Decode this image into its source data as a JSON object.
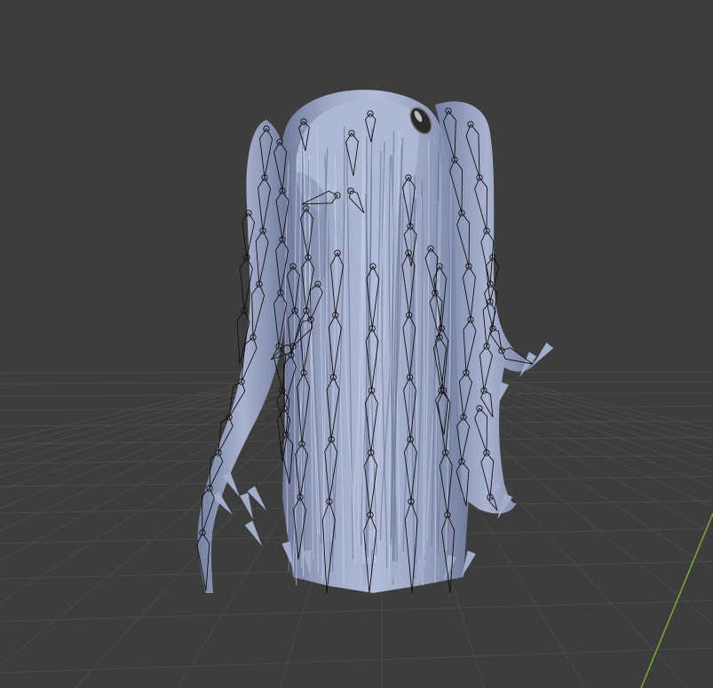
{
  "viewport": {
    "background_color": "#3d3d3d",
    "grid_color": "#4a4a4a",
    "axis_y_color": "#7aa23a",
    "mesh_color": "#aab4cf",
    "mesh_shadow_color": "#6d7898",
    "armature_color": "#111111",
    "accessory_color": "#2a2a2a",
    "object_name": "hair",
    "object_type": "mesh-with-armature",
    "bone_display": "octahedral",
    "hair_style": "long-twin-tails"
  }
}
